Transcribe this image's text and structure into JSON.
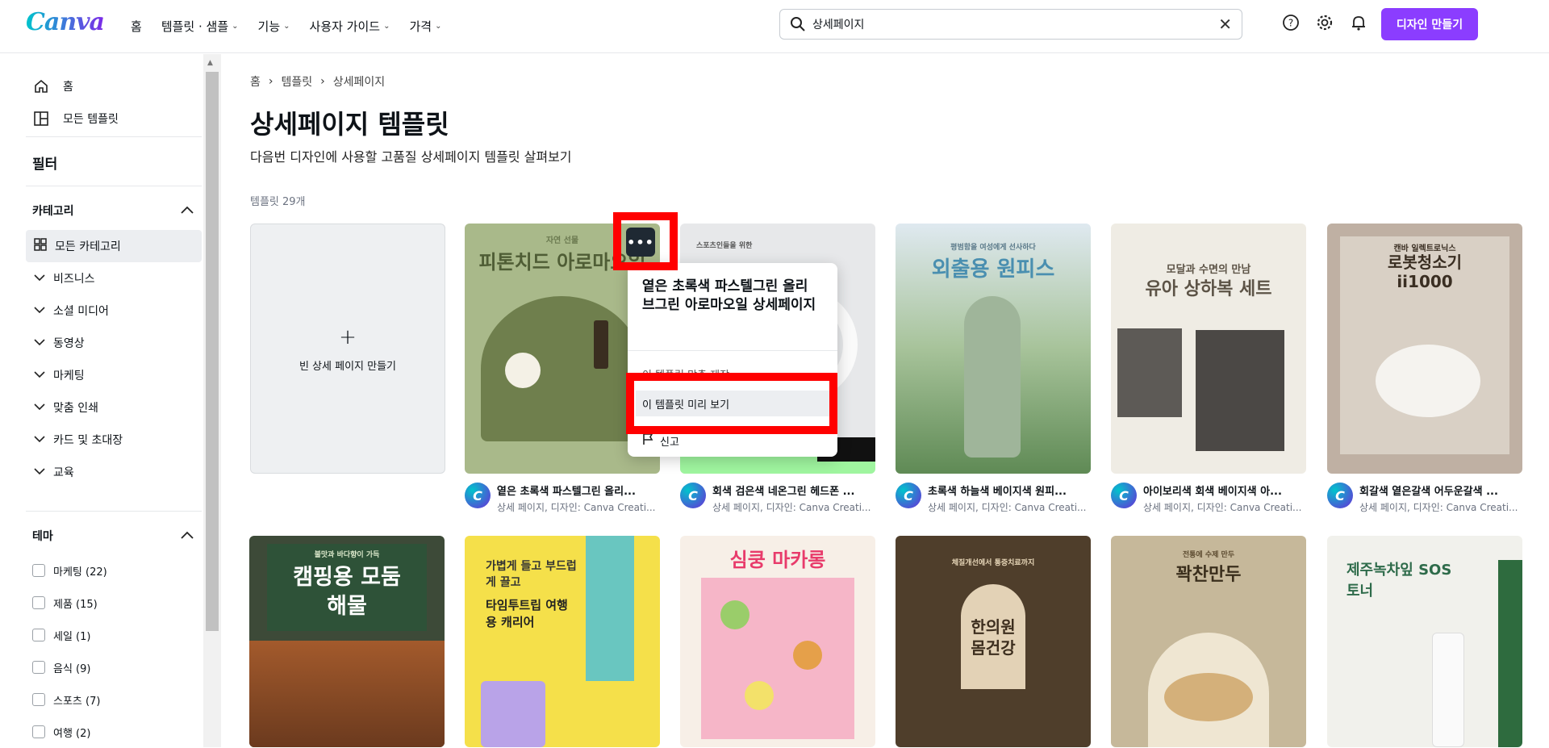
{
  "header": {
    "logo": "Canva",
    "nav": [
      {
        "label": "홈",
        "has_dropdown": false
      },
      {
        "label": "템플릿 · 샘플",
        "has_dropdown": true
      },
      {
        "label": "기능",
        "has_dropdown": true
      },
      {
        "label": "사용자 가이드",
        "has_dropdown": true
      },
      {
        "label": "가격",
        "has_dropdown": true
      }
    ],
    "search_value": "상세페이지",
    "create_label": "디자인 만들기"
  },
  "sidebar": {
    "home": "홈",
    "all_templates": "모든 템플릿",
    "filter_title": "필터",
    "category_title": "카테고리",
    "categories": [
      "모든 카테고리",
      "비즈니스",
      "소셜 미디어",
      "동영상",
      "마케팅",
      "맞춤 인쇄",
      "카드 및 초대장",
      "교육"
    ],
    "theme_title": "테마",
    "themes": [
      "마케팅 (22)",
      "제품 (15)",
      "세일 (1)",
      "음식 (9)",
      "스포츠 (7)",
      "여행 (2)"
    ]
  },
  "main": {
    "breadcrumb": [
      "홈",
      "템플릿",
      "상세페이지"
    ],
    "title": "상세페이지 템플릿",
    "subtitle": "다음번 디자인에 사용할 고품질 상세페이지 템플릿 살펴보기",
    "count": "템플릿 29개",
    "blank_card_label": "빈 상세 페이지 만들기",
    "row1": [
      {
        "name": "옅은 초록색 파스텔그린 올리...",
        "sub": "상세 페이지, 디자인: Canva Creati...",
        "thumb_text": "피톤치드 아로마오일",
        "thumb_top": "자연 선물",
        "bg": "#a9b98a"
      },
      {
        "name": "회색 검은색 네온그린 헤드폰 ...",
        "sub": "상세 페이지, 디자인: Canva Creati...",
        "thumb_text": "",
        "thumb_top": "스포츠인들을 위한",
        "bg": "#e7e8ea"
      },
      {
        "name": "초록색 하늘색 베이지색 원피...",
        "sub": "상세 페이지, 디자인: Canva Creati...",
        "thumb_text": "외출용 원피스",
        "thumb_top": "평범함을 여성에게 선사하다",
        "bg": "#7fa872"
      },
      {
        "name": "아이보리색 회색 베이지색 아...",
        "sub": "상세 페이지, 디자인: Canva Creati...",
        "thumb_text": "유아 상하복 세트",
        "thumb_top": "모달과 수면의 만남",
        "bg": "#efece4"
      },
      {
        "name": "회갈색 옅은갈색 어두운갈색 ...",
        "sub": "상세 페이지, 디자인: Canva Creati...",
        "thumb_text": "로봇청소기 ii1000",
        "thumb_top": "캔바 일렉트로닉스",
        "bg": "#bfb0a3"
      }
    ],
    "row2": [
      {
        "thumb_text": "캠핑용 모둠해물",
        "thumb_top": "불맛과 바다향이 가득",
        "bg": "#3d4a38"
      },
      {
        "thumb_text": "타임투트립 여행용 캐리어",
        "thumb_top": "가볍게 들고 부드럽게 끌고",
        "bg": "#f5e04a"
      },
      {
        "thumb_text": "심쿵 마카롱",
        "thumb_top": "",
        "bg": "#f6b6c8"
      },
      {
        "thumb_text": "한의원 몸건강",
        "thumb_top": "체질개선에서 통증치료까지",
        "bg": "#4f3e2b"
      },
      {
        "thumb_text": "꽉찬만두",
        "thumb_top": "전통에 수제 만두",
        "bg": "#c6b89a"
      },
      {
        "thumb_text": "제주녹차잎 SOS 토너",
        "thumb_top": "",
        "bg": "#f1f1ec"
      }
    ]
  },
  "dropdown": {
    "title": "옅은 초록색 파스텔그린 올리브그린 아로마오일 상세페이지",
    "item1": "이 템플릿 맞춤 제작",
    "item2": "이 템플릿 미리 보기",
    "item3": "신고"
  },
  "colors": {
    "brand": "#8b3dff",
    "highlight": "#ff0000"
  }
}
